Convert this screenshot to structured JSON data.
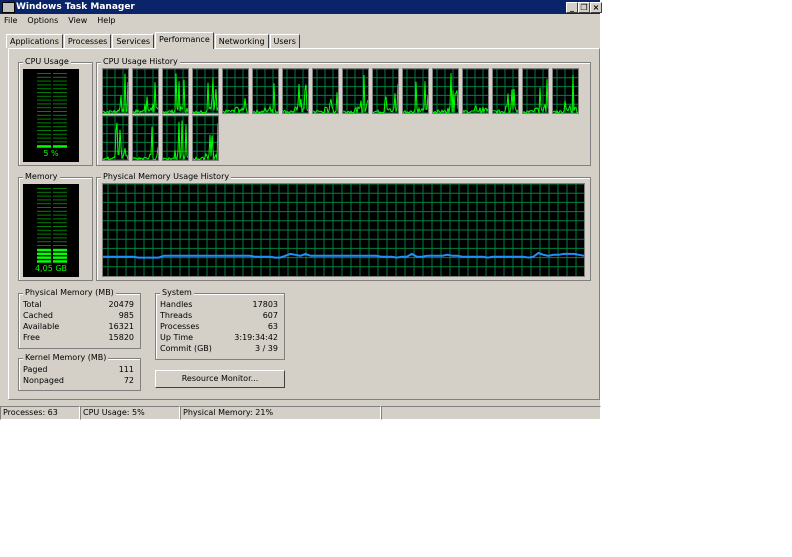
{
  "window": {
    "title": "Windows Task Manager"
  },
  "menu": [
    "File",
    "Options",
    "View",
    "Help"
  ],
  "tabs": [
    {
      "label": "Applications"
    },
    {
      "label": "Processes"
    },
    {
      "label": "Services"
    },
    {
      "label": "Performance",
      "active": true
    },
    {
      "label": "Networking"
    },
    {
      "label": "Users"
    }
  ],
  "cpu": {
    "label": "CPU Usage",
    "value": "5 %",
    "percent": 5,
    "history_label": "CPU Usage History",
    "cores": 20
  },
  "memory": {
    "label": "Memory",
    "value": "4,05 GB",
    "percent": 21,
    "history_label": "Physical Memory Usage History",
    "history": [
      21,
      21,
      21,
      21,
      21,
      21,
      21,
      20,
      20,
      20,
      20,
      20,
      22,
      22,
      22,
      22,
      22,
      22,
      22,
      22,
      22,
      22,
      22,
      22,
      22,
      22,
      22,
      22,
      22,
      22,
      21,
      21,
      21,
      21,
      20,
      20,
      22,
      24,
      23,
      22,
      24,
      22,
      22,
      22,
      22,
      22,
      22,
      22,
      22,
      22,
      22,
      22,
      22,
      22,
      22,
      21,
      21,
      21,
      20,
      21,
      21,
      24,
      21,
      21,
      22,
      22,
      22,
      22,
      23,
      22,
      22,
      21,
      21,
      21,
      21,
      21,
      20,
      21,
      21,
      21,
      21,
      21,
      21,
      21,
      20,
      21,
      25,
      23,
      22,
      23,
      23,
      24,
      24,
      24,
      23,
      22
    ]
  },
  "physical_memory": {
    "label": "Physical Memory (MB)",
    "rows": [
      {
        "k": "Total",
        "v": "20479"
      },
      {
        "k": "Cached",
        "v": "985"
      },
      {
        "k": "Available",
        "v": "16321"
      },
      {
        "k": "Free",
        "v": "15820"
      }
    ]
  },
  "kernel_memory": {
    "label": "Kernel Memory (MB)",
    "rows": [
      {
        "k": "Paged",
        "v": "111"
      },
      {
        "k": "Nonpaged",
        "v": "72"
      }
    ]
  },
  "system": {
    "label": "System",
    "rows": [
      {
        "k": "Handles",
        "v": "17803"
      },
      {
        "k": "Threads",
        "v": "607"
      },
      {
        "k": "Processes",
        "v": "63"
      },
      {
        "k": "Up Time",
        "v": "3:19:34:42"
      },
      {
        "k": "Commit (GB)",
        "v": "3 / 39"
      }
    ]
  },
  "resource_monitor_label": "Resource Monitor...",
  "status": {
    "processes": "Processes: 63",
    "cpu": "CPU Usage: 5%",
    "memory": "Physical Memory: 21%"
  },
  "colors": {
    "graph_green": "#00ff00",
    "grid": "#008040",
    "mem_line": "#1e90ff",
    "title": "#0a246a"
  }
}
